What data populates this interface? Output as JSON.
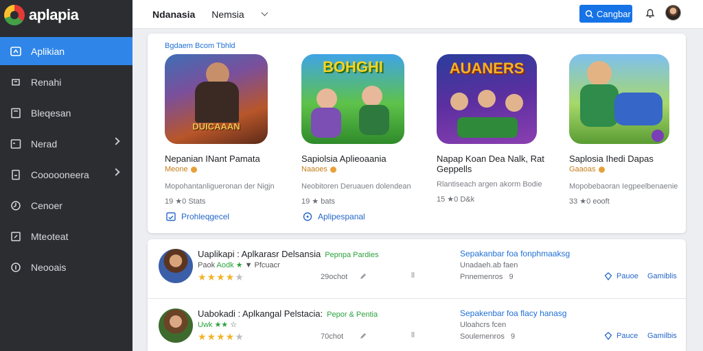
{
  "brand": {
    "name": "aplapia"
  },
  "sidebar": {
    "items": [
      {
        "label": "Aplikian",
        "icon": "apps-icon",
        "active": true,
        "chevron": false
      },
      {
        "label": "Renahi",
        "icon": "refresh-icon",
        "active": false,
        "chevron": false
      },
      {
        "label": "Bleqesan",
        "icon": "page-icon",
        "active": false,
        "chevron": false
      },
      {
        "label": "Nerad",
        "icon": "box-icon",
        "active": false,
        "chevron": true
      },
      {
        "label": "Coooooneera",
        "icon": "document-icon",
        "active": false,
        "chevron": true
      },
      {
        "label": "Cenoer",
        "icon": "clock-icon",
        "active": false,
        "chevron": false
      },
      {
        "label": "Mteoteat",
        "icon": "edit-icon",
        "active": false,
        "chevron": false
      },
      {
        "label": "Neooais",
        "icon": "info-icon",
        "active": false,
        "chevron": false
      }
    ]
  },
  "header": {
    "title": "Ndanasia",
    "select_value": "Nemsia",
    "button_label": "Cangbar",
    "colors": {
      "button": "#1673e6"
    }
  },
  "featured": {
    "title": "Bgdaem Bcom Tbhld",
    "apps": [
      {
        "image_text": "DUICAAAN",
        "name": "Nepanian INant Pamata",
        "rating": "Meone",
        "desc": "Mopohantanligueronan der Nigjn",
        "stats": "19 ★0 Stats"
      },
      {
        "image_text": "BOHGHI",
        "name": "Sapiolsia Aplieoaania",
        "rating": "Naaoes",
        "desc": "Neobitoren Deruauen dolendean",
        "stats": "19 ★ bats"
      },
      {
        "image_text": "AUANERS",
        "name": "Napap Koan Dea Nalk, Rat Geppells",
        "rating": "",
        "desc": "Rlantiseach argen akorm Bodie",
        "stats": "15 ★0 D&k"
      },
      {
        "image_text": "",
        "name": "Saplosia Ihedi Dapas",
        "rating": "Gaaoas",
        "desc": "Mopobebaoran Iegpeelbenaenie",
        "stats": "33 ★0 eooft"
      }
    ],
    "links": [
      "Prohleqgecel",
      "Aplipespanal"
    ]
  },
  "list": [
    {
      "title": "Uaplikapi : Aplkarasr Delsansia",
      "tag": "Pepnpa Pardies",
      "sub_prefix": "Paok",
      "sub_green": "Aodk ★",
      "sub_rest": "▼ Pfcuacr",
      "rating": 4.5,
      "count": "29ochot",
      "sep": "ll",
      "link": "Sepakanbar foa fonphmaaksg",
      "meta": "Unadaeh.ab faen",
      "meta2": "Pnnemenros",
      "meta2_num": "9",
      "btn1": "Pauoe",
      "btn2": "Gamiblis"
    },
    {
      "title": "Uabokadi : Aplkangal Pelstacia:",
      "tag": "Pepor & Pentia",
      "sub_prefix": "",
      "sub_green": "Uwk ★★",
      "sub_rest": "☆",
      "rating": 4.5,
      "count": "70chot",
      "sep": "ll",
      "link": "Sepakenbar foa flacy hanasg",
      "meta": "Uloahcrs fcen",
      "meta2": "Soulemenros",
      "meta2_num": "9",
      "btn1": "Pauce",
      "btn2": "Gamilbis"
    }
  ]
}
